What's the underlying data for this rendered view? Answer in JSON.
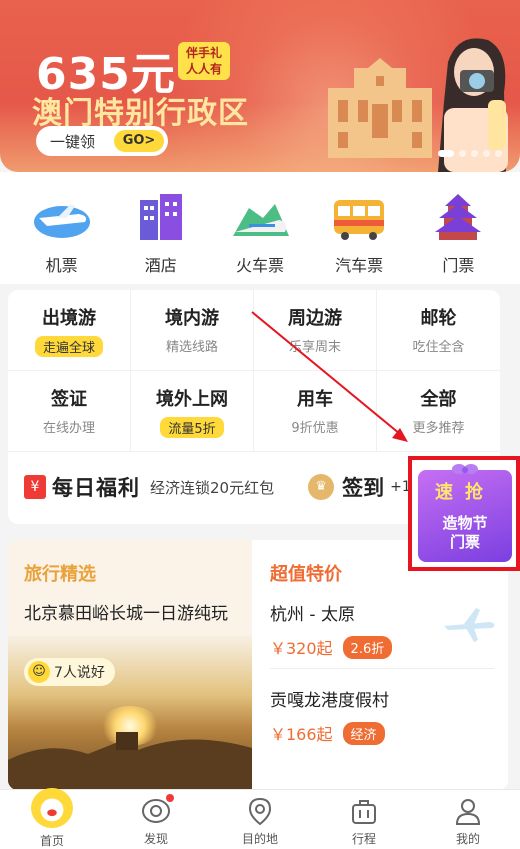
{
  "banner": {
    "price": "635元",
    "gift_tag_line1": "伴手礼",
    "gift_tag_line2": "人人有",
    "region": "澳门特别行政区",
    "claim_label": "一键领",
    "go_label": "GO>",
    "slides_total": 5,
    "slide_active": 1
  },
  "categories": [
    {
      "label": "机票",
      "icon": "airplane-icon"
    },
    {
      "label": "酒店",
      "icon": "hotel-icon"
    },
    {
      "label": "火车票",
      "icon": "train-icon"
    },
    {
      "label": "汽车票",
      "icon": "bus-icon"
    },
    {
      "label": "门票",
      "icon": "temple-icon"
    }
  ],
  "services": [
    {
      "title": "出境游",
      "sub": "走遍全球",
      "highlight": true
    },
    {
      "title": "境内游",
      "sub": "精选线路",
      "highlight": false
    },
    {
      "title": "周边游",
      "sub": "乐享周末",
      "highlight": false
    },
    {
      "title": "邮轮",
      "sub": "吃住全含",
      "highlight": false
    },
    {
      "title": "签证",
      "sub": "在线办理",
      "highlight": false
    },
    {
      "title": "境外上网",
      "sub": "流量5折",
      "highlight": true
    },
    {
      "title": "用车",
      "sub": "9折优惠",
      "highlight": false
    },
    {
      "title": "全部",
      "sub": "更多推荐",
      "highlight": false
    }
  ],
  "promo": {
    "box_char": "¥",
    "brand": "每日福利",
    "desc": "经济连锁20元红包",
    "sign": "签到",
    "plus": "+1"
  },
  "flash_sale": {
    "line1": "速抢",
    "line2a": "造物节",
    "line2b": "门票"
  },
  "picks": {
    "left_title": "旅行精选",
    "tour_title": "北京慕田峪长城一日游纯玩",
    "likes": "7人说好",
    "right_title": "超值特价",
    "deals": [
      {
        "route": "杭州 - 太原",
        "price": "￥320起",
        "tag": "2.6折"
      },
      {
        "route": "贡嘎龙港度假村",
        "price": "￥166起",
        "tag": "经济"
      }
    ]
  },
  "tabbar": [
    {
      "label": "首页",
      "icon": "home-pig-icon"
    },
    {
      "label": "发现",
      "icon": "discover-eye-icon"
    },
    {
      "label": "目的地",
      "icon": "location-pin-icon"
    },
    {
      "label": "行程",
      "icon": "suitcase-icon"
    },
    {
      "label": "我的",
      "icon": "user-icon"
    }
  ],
  "colors": {
    "accent_orange": "#ef6d33",
    "accent_yellow": "#ffd93a",
    "banner_red": "#e5584a",
    "annotation_red": "#e6151f"
  }
}
